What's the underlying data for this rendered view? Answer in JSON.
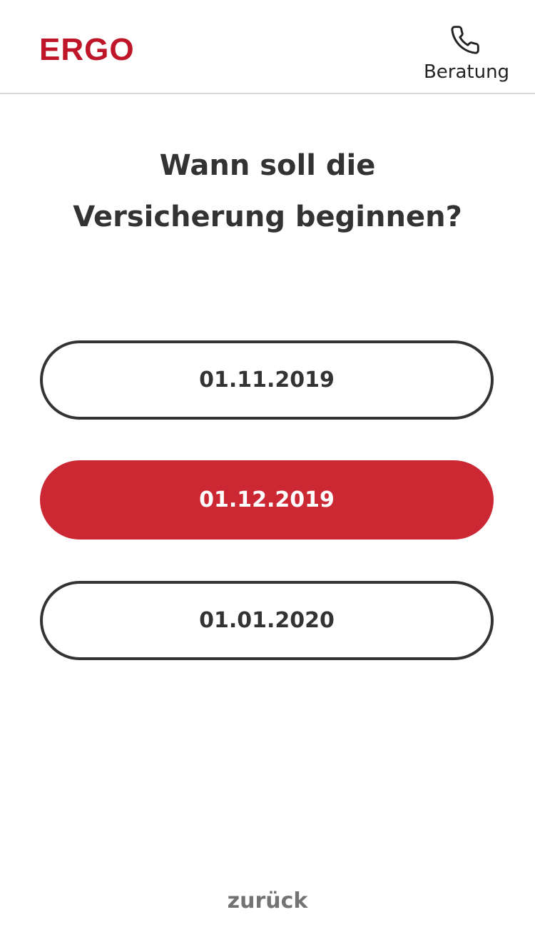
{
  "header": {
    "logo_text": "ERGO",
    "consult_label": "Beratung",
    "consult_icon": "phone-icon"
  },
  "question": {
    "line1": "Wann soll die",
    "line2": "Versicherung beginnen?"
  },
  "options": [
    {
      "label": "01.11.2019",
      "selected": false
    },
    {
      "label": "01.12.2019",
      "selected": true
    },
    {
      "label": "01.01.2020",
      "selected": false
    }
  ],
  "footer": {
    "back_label": "zurück"
  },
  "colors": {
    "brand_red": "#bf1528",
    "selected_bg": "#cc2834",
    "text_dark": "#333333",
    "text_muted": "#737373",
    "divider": "#d9d9d9"
  }
}
